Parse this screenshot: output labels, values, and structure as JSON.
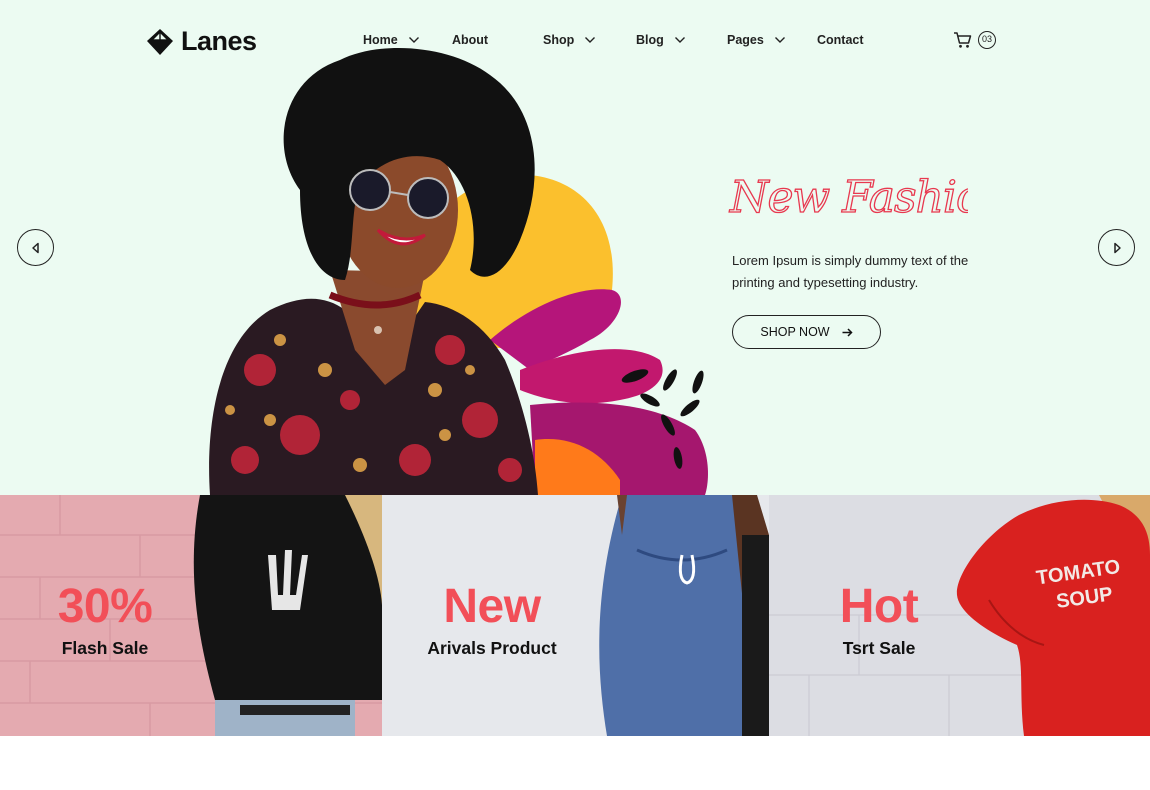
{
  "brand": {
    "name": "Lanes"
  },
  "nav": {
    "items": [
      {
        "label": "Home",
        "has_dropdown": true
      },
      {
        "label": "About",
        "has_dropdown": false
      },
      {
        "label": "Shop",
        "has_dropdown": true
      },
      {
        "label": "Blog",
        "has_dropdown": true
      },
      {
        "label": "Pages",
        "has_dropdown": true
      },
      {
        "label": "Contact",
        "has_dropdown": false
      }
    ]
  },
  "cart": {
    "icon": "cart-icon",
    "count": "03"
  },
  "hero": {
    "script_title": "New Fashion",
    "description": "Lorem Ipsum is simply dummy text of the printing and typesetting industry.",
    "cta_label": "SHOP NOW",
    "cta_icon": "arrow-right-icon",
    "prev_icon": "chevron-left-icon",
    "next_icon": "chevron-right-icon"
  },
  "promos": [
    {
      "big": "30%",
      "small": "Flash Sale"
    },
    {
      "big": "New",
      "small": "Arivals Product"
    },
    {
      "big": "Hot",
      "small": "Tsrt Sale"
    }
  ],
  "colors": {
    "hero_background": "#ecfbf2",
    "accent_red": "#f24f58",
    "text_dark": "#111111"
  }
}
